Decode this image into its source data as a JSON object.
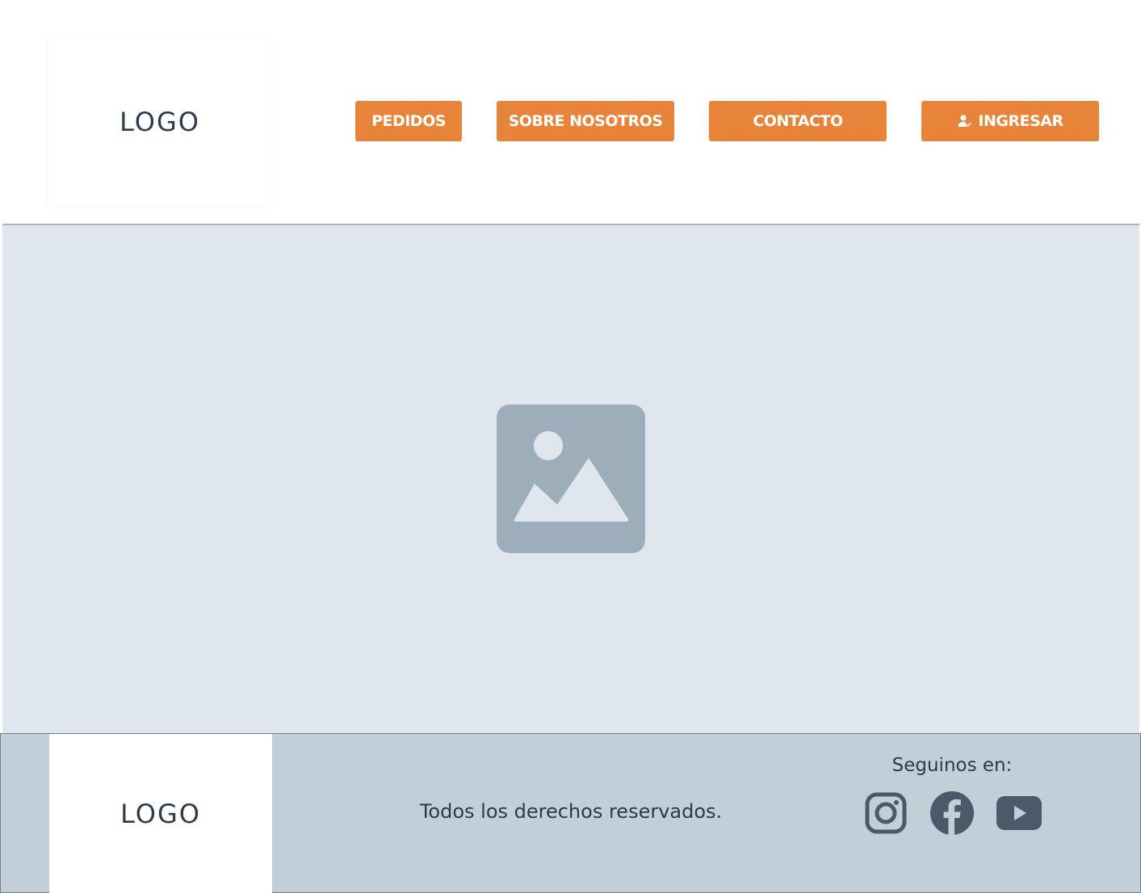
{
  "header": {
    "logo_text": "LOGO",
    "nav": [
      {
        "label": "PEDIDOS"
      },
      {
        "label": "SOBRE NOSOTROS"
      },
      {
        "label": "CONTACTO"
      },
      {
        "label": "INGRESAR",
        "icon": "user-check-icon"
      }
    ]
  },
  "hero": {
    "icon": "image-placeholder-icon"
  },
  "footer": {
    "logo_text": "LOGO",
    "copyright": "Todos los derechos reservados.",
    "follow_label": "Seguinos en:",
    "social": [
      {
        "icon": "instagram-icon"
      },
      {
        "icon": "facebook-icon"
      },
      {
        "icon": "youtube-icon"
      }
    ]
  },
  "colors": {
    "accent": "#e8843a",
    "hero_bg": "#dfe6ee",
    "footer_bg": "#c2cfd9",
    "icon_gray": "#9eadba",
    "social_dark": "#4a5a69",
    "text_dark": "#2c3a4b"
  }
}
